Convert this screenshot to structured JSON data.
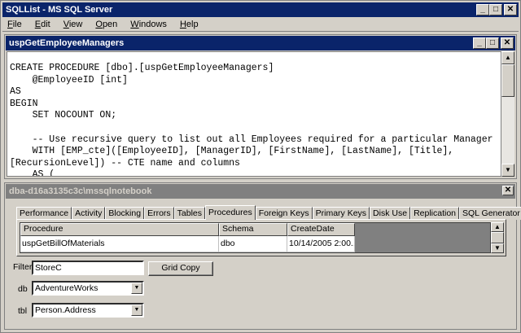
{
  "app": {
    "title": "SQLList - MS SQL Server",
    "window_buttons": {
      "minimize": "_",
      "maximize": "□",
      "close": "✕"
    }
  },
  "menu": [
    {
      "label": "File",
      "accel": "F",
      "rest": "ile"
    },
    {
      "label": "Edit",
      "accel": "E",
      "rest": "dit"
    },
    {
      "label": "View",
      "accel": "V",
      "rest": "iew"
    },
    {
      "label": "Open",
      "accel": "O",
      "rest": "pen"
    },
    {
      "label": "Windows",
      "accel": "W",
      "rest": "indows"
    },
    {
      "label": "Help",
      "accel": "H",
      "rest": "elp"
    }
  ],
  "editor": {
    "title": "uspGetEmployeeManagers",
    "code": "CREATE PROCEDURE [dbo].[uspGetEmployeeManagers]\n    @EmployeeID [int]\nAS\nBEGIN\n    SET NOCOUNT ON;\n\n    -- Use recursive query to list out all Employees required for a particular Manager\n    WITH [EMP_cte]([EmployeeID], [ManagerID], [FirstName], [LastName], [Title],\n[RecursionLevel]) -- CTE name and columns\n    AS ("
  },
  "notebook": {
    "title": "dba-d16a3135c3c\\mssqlnotebook",
    "tabs": [
      "Performance",
      "Activity",
      "Blocking",
      "Errors",
      "Tables",
      "Procedures",
      "Foreign Keys",
      "Primary Keys",
      "Disk Use",
      "Replication",
      "SQL Generator"
    ],
    "active_tab": "Procedures",
    "grid": {
      "columns": [
        "Procedure",
        "Schema",
        "CreateDate"
      ],
      "rows": [
        [
          "uspGetBillOfMaterials",
          "dbo",
          "10/14/2005 2:00..."
        ]
      ]
    },
    "filter": {
      "label": "Filter",
      "value": "StoreC"
    },
    "grid_copy_label": "Grid Copy",
    "db": {
      "label": "db",
      "value": "AdventureWorks"
    },
    "tbl": {
      "label": "tbl",
      "value": "Person.Address"
    }
  }
}
